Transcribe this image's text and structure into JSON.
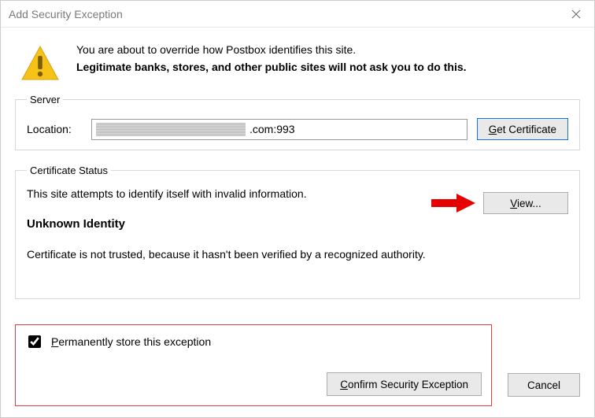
{
  "titlebar": {
    "title": "Add Security Exception"
  },
  "intro": {
    "line1": "You are about to override how Postbox identifies this site.",
    "line2": "Legitimate banks, stores, and other public sites will not ask you to do this."
  },
  "server": {
    "legend": "Server",
    "location_label": "Location:",
    "location_value": ".com:993",
    "get_cert_prefix": "G",
    "get_cert_rest": "et Certificate"
  },
  "cert": {
    "legend": "Certificate Status",
    "line1": "This site attempts to identify itself with invalid information.",
    "heading": "Unknown Identity",
    "desc": "Certificate is not trusted, because it hasn't been verified by a recognized authority.",
    "view_prefix": "V",
    "view_rest": "iew..."
  },
  "perm": {
    "checkbox_prefix": "P",
    "checkbox_rest": "ermanently store this exception"
  },
  "actions": {
    "confirm_prefix": "C",
    "confirm_rest": "onfirm Security Exception",
    "cancel": "Cancel"
  }
}
